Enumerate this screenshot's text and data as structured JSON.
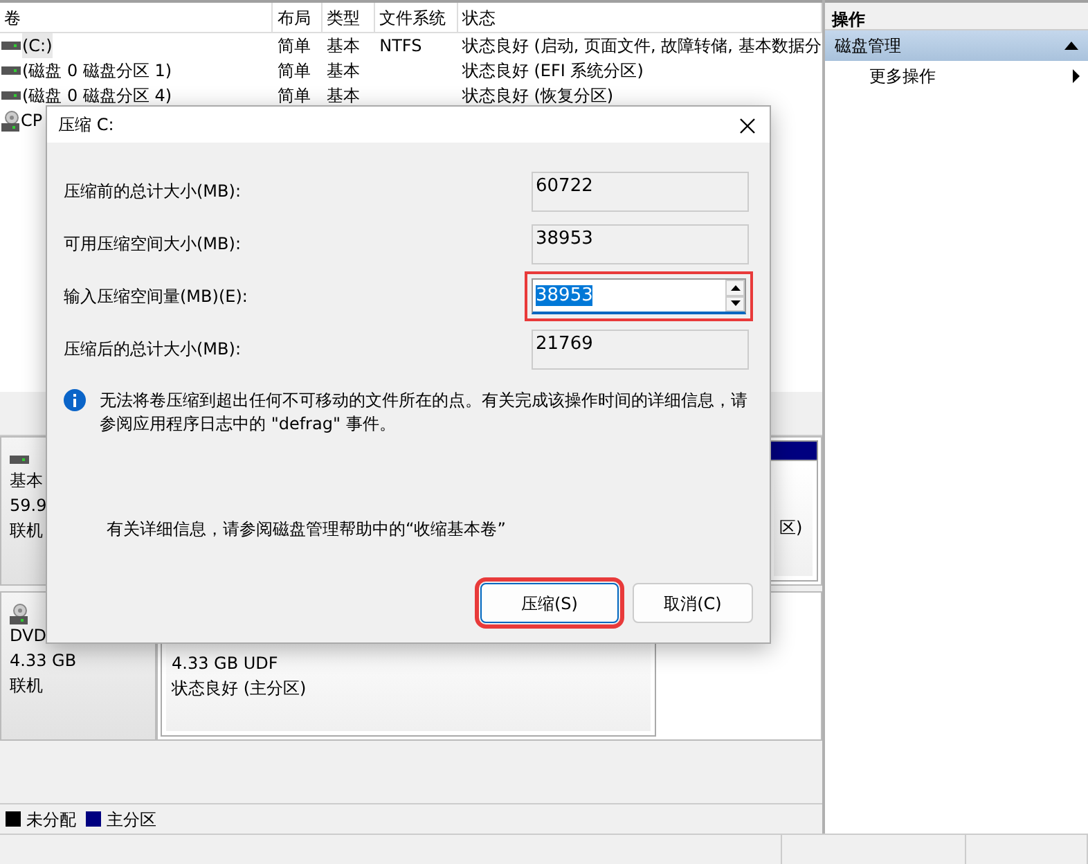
{
  "volume_table": {
    "columns": [
      "卷",
      "布局",
      "类型",
      "文件系统",
      "状态"
    ],
    "rows": [
      {
        "kind": "disk",
        "selected": true,
        "cells": [
          "(C:)",
          "简单",
          "基本",
          "NTFS",
          "状态良好 (启动, 页面文件, 故障转储, 基本数据分"
        ]
      },
      {
        "kind": "disk",
        "selected": false,
        "cells": [
          "(磁盘 0 磁盘分区 1)",
          "简单",
          "基本",
          "",
          "状态良好 (EFI 系统分区)"
        ]
      },
      {
        "kind": "disk",
        "selected": false,
        "cells": [
          "(磁盘 0 磁盘分区 4)",
          "简单",
          "基本",
          "",
          "状态良好 (恢复分区)"
        ]
      },
      {
        "kind": "cd",
        "selected": false,
        "cells": [
          "CP"
        ]
      }
    ]
  },
  "disks": [
    {
      "kind": "disk",
      "lines": [
        "基本",
        "59.9",
        "联机"
      ],
      "partitions": [
        {
          "kind": "primary",
          "lines": [
            "区)"
          ]
        }
      ]
    },
    {
      "kind": "cd",
      "lines": [
        "DVD",
        "4.33 GB",
        "联机"
      ],
      "partitions": [
        {
          "lines": [
            "4.33 GB UDF",
            "状态良好 (主分区)"
          ]
        }
      ]
    }
  ],
  "legend": [
    {
      "label": "未分配",
      "color": "#000000"
    },
    {
      "label": "主分区",
      "color": "#000080"
    }
  ],
  "actions": {
    "title": "操作",
    "section": {
      "label": "磁盘管理",
      "expanded": true
    },
    "items": [
      {
        "label": "更多操作"
      }
    ]
  },
  "dialog": {
    "title": "压缩 C:",
    "fields": [
      {
        "kind": "readonly",
        "label": "压缩前的总计大小(MB):",
        "value": "60722"
      },
      {
        "kind": "readonly",
        "label": "可用压缩空间大小(MB):",
        "value": "38953"
      },
      {
        "kind": "spin",
        "label": "输入压缩空间量(MB)(E):",
        "value": "38953",
        "highlighted": true
      },
      {
        "kind": "readonly",
        "label": "压缩后的总计大小(MB):",
        "value": "21769"
      }
    ],
    "info": "无法将卷压缩到超出任何不可移动的文件所在的点。有关完成该操作时间的详细信息，请参阅应用程序日志中的 \"defrag\" 事件。",
    "help": "有关详细信息，请参阅磁盘管理帮助中的“收缩基本卷”",
    "buttons": [
      {
        "label": "压缩(S)",
        "highlighted": true
      },
      {
        "label": "取消(C)",
        "highlighted": false
      }
    ]
  }
}
